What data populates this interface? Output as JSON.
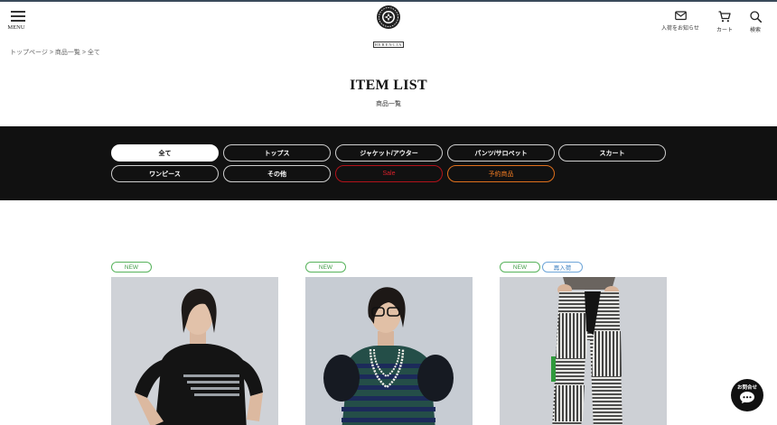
{
  "header": {
    "menu_label": "MENU",
    "logo_text": "HERENCIA",
    "icons": [
      {
        "name": "mail-icon",
        "label": "入荷をお知らせ"
      },
      {
        "name": "cart-icon",
        "label": "カート"
      },
      {
        "name": "search-icon",
        "label": "検索"
      }
    ]
  },
  "breadcrumb": {
    "items": [
      "トップページ",
      "商品一覧",
      "全て"
    ],
    "separator": ">"
  },
  "page": {
    "title": "ITEM LIST",
    "subtitle": "商品一覧"
  },
  "categories": [
    {
      "label": "全て",
      "state": "active"
    },
    {
      "label": "トップス",
      "state": "normal"
    },
    {
      "label": "ジャケット/アウター",
      "state": "normal"
    },
    {
      "label": "パンツ/サロペット",
      "state": "normal"
    },
    {
      "label": "スカート",
      "state": "normal"
    },
    {
      "label": "ワンピース",
      "state": "normal"
    },
    {
      "label": "その他",
      "state": "normal"
    },
    {
      "label": "Sale",
      "state": "sale"
    },
    {
      "label": "予約商品",
      "state": "preorder"
    }
  ],
  "products": [
    {
      "badges": [
        "NEW"
      ]
    },
    {
      "badges": [
        "NEW"
      ]
    },
    {
      "badges": [
        "NEW",
        "再入荷"
      ]
    }
  ],
  "chat": {
    "label": "お問合せ"
  },
  "colors": {
    "band": "#111111",
    "new_badge": "#57b35c",
    "restock_badge": "#6ea5d8",
    "sale": "#d8202a",
    "preorder": "#ef7a22"
  }
}
